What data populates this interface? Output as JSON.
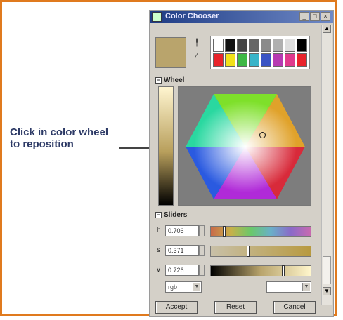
{
  "callout": {
    "line1": "Click in color wheel",
    "line2": "to reposition"
  },
  "window": {
    "title": "Color Chooser",
    "buttons": [
      "_",
      "□",
      "×"
    ]
  },
  "current_color": "#b9a46c",
  "tools": [
    "eyedropper-icon",
    "pipette-icon"
  ],
  "palette": {
    "row1": [
      "#ffffff",
      "#111111",
      "#444444",
      "#666666",
      "#8a8a8a",
      "#b0b0b0",
      "#dedede",
      "#000000"
    ],
    "row2": [
      "#e8232a",
      "#f2e11a",
      "#3fb845",
      "#39b4c9",
      "#3a54c4",
      "#b73ab2",
      "#e03a8d",
      "#e8242c"
    ]
  },
  "wheel_section": {
    "label": "Wheel",
    "toggle": "−"
  },
  "sliders_section": {
    "label": "Sliders",
    "toggle": "−",
    "rows": [
      {
        "label": "h",
        "value": "0.706",
        "thumb": 0.12,
        "gradient": "linear-gradient(to right,#c86a4a,#c8b04a,#6ac86a,#6ab0c8,#8a6ac8,#c86ab0)"
      },
      {
        "label": "s",
        "value": "0.371",
        "thumb": 0.37,
        "gradient": "linear-gradient(to right,#c8c0a8,#b89a40)"
      },
      {
        "label": "v",
        "value": "0.726",
        "thumb": 0.73,
        "gradient": "linear-gradient(to right,#000000,#b9a46c,#fff6cc)"
      }
    ]
  },
  "combos": {
    "left": "rgb",
    "right": ""
  },
  "buttons": {
    "accept": "Accept",
    "reset": "Reset",
    "cancel": "Cancel"
  }
}
